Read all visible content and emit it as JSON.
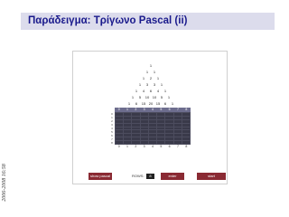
{
  "slide": {
    "title": "Παράδειγμα: Τρίγωνο Pascal (ii)",
    "side_note": "2006-2008  16:58"
  },
  "applet": {
    "triangle_rows": [
      [
        "1"
      ],
      [
        "1",
        "1"
      ],
      [
        "1",
        "2",
        "1"
      ],
      [
        "1",
        "3",
        "3",
        "1"
      ],
      [
        "1",
        "4",
        "6",
        "4",
        "1"
      ],
      [
        "1",
        "5",
        "10",
        "10",
        "5",
        "1"
      ],
      [
        "1",
        "6",
        "15",
        "20",
        "15",
        "6",
        "1"
      ],
      [
        "1",
        "7",
        "21",
        "35",
        "35",
        "21",
        "7",
        "1"
      ],
      [
        "1",
        "8",
        "28",
        "56",
        "70",
        "56",
        "28",
        "8",
        "1"
      ]
    ],
    "grid_columns": [
      "0",
      "1",
      "2",
      "3",
      "4",
      "5",
      "6",
      "7",
      "8"
    ],
    "grid_rows": [
      "0",
      "1",
      "2",
      "3",
      "4",
      "5",
      "6",
      "7",
      "8"
    ],
    "controls": {
      "show_pascal_label": "show pascal",
      "rows_label": "ROWS:",
      "rows_value": "8",
      "enter_label": "enter",
      "start_label": "start"
    }
  },
  "colors": {
    "title_text": "#1a1a8c",
    "title_band": "#dcdcec",
    "button": "#8a2a33",
    "grid": "#3a3a4a"
  }
}
